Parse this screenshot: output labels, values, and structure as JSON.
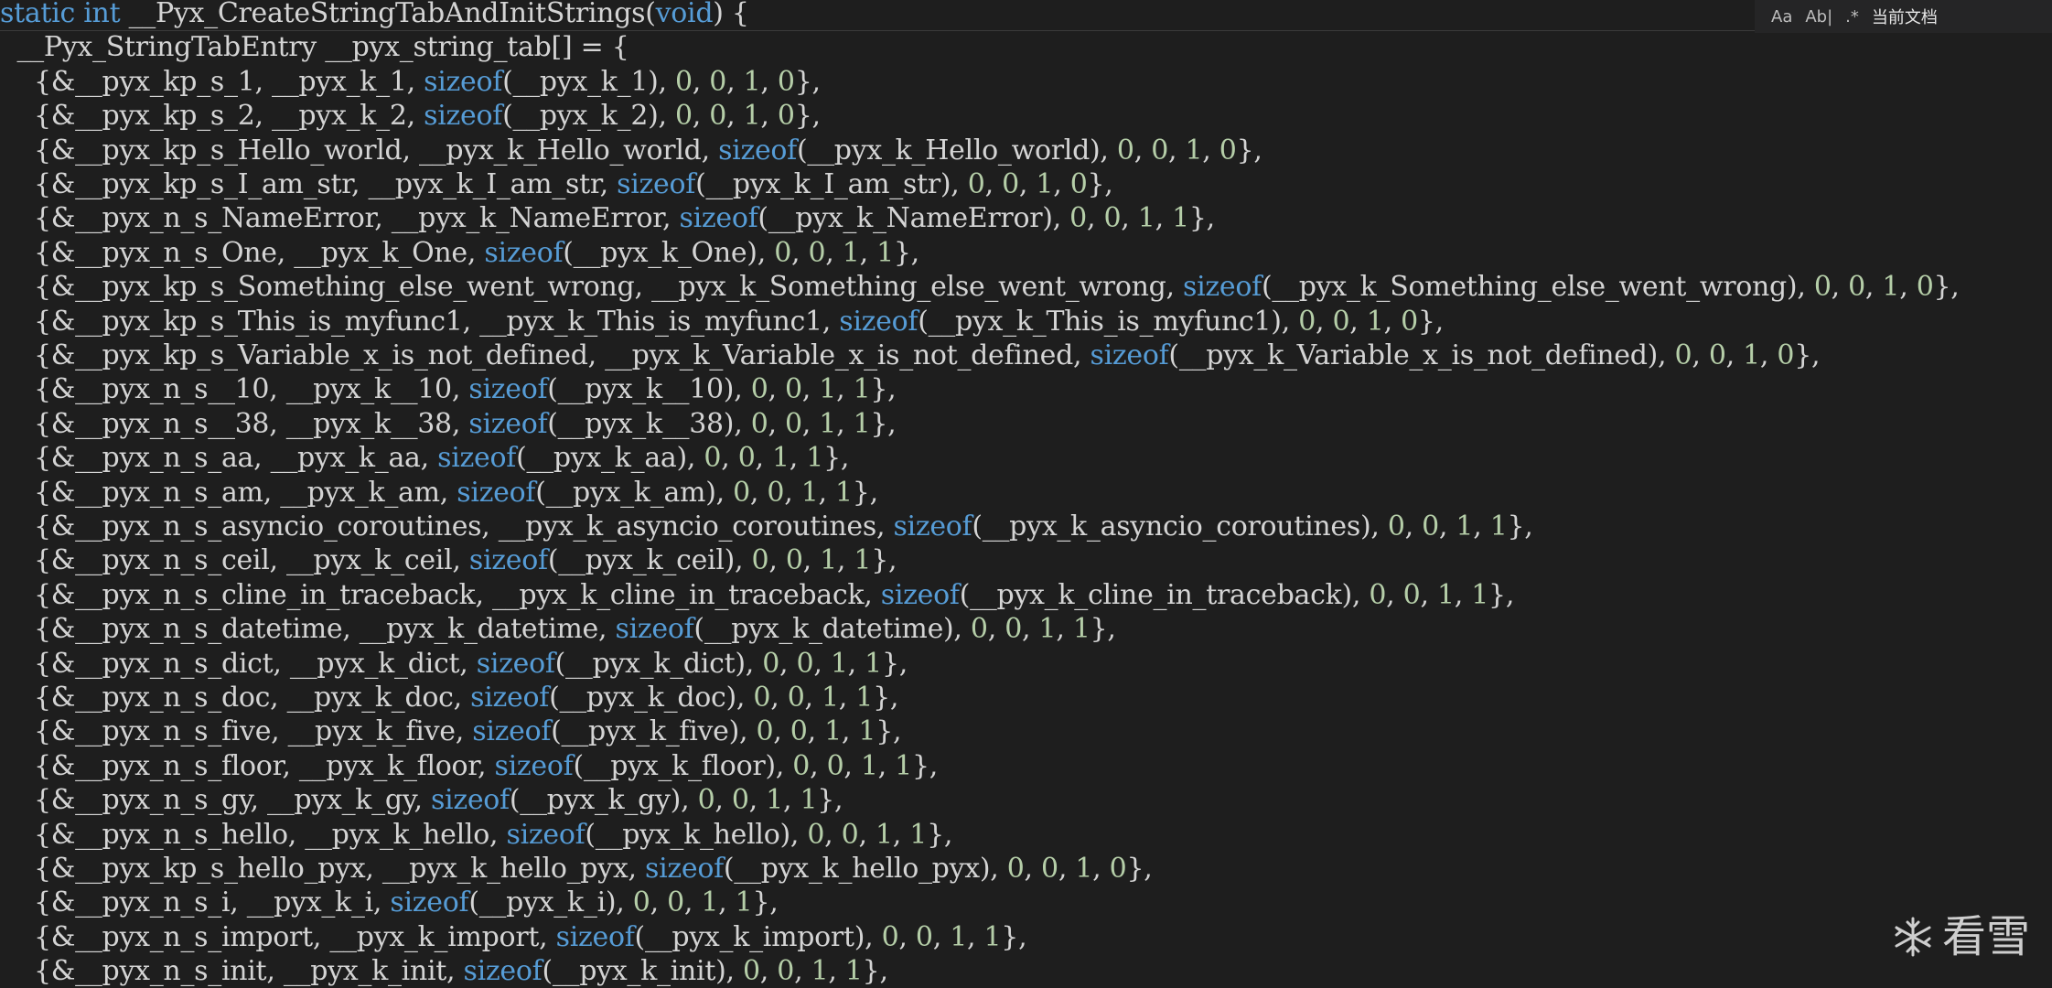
{
  "findbar": {
    "match_case_label": "Aa",
    "whole_word_label": "Ab|",
    "regex_label": ".*",
    "scope_label": "当前文档"
  },
  "editor": {
    "lines": [
      "static int __Pyx_CreateStringTabAndInitStrings(void) {",
      "  __Pyx_StringTabEntry __pyx_string_tab[] = {",
      "    {&__pyx_kp_s_1, __pyx_k_1, sizeof(__pyx_k_1), 0, 0, 1, 0},",
      "    {&__pyx_kp_s_2, __pyx_k_2, sizeof(__pyx_k_2), 0, 0, 1, 0},",
      "    {&__pyx_kp_s_Hello_world, __pyx_k_Hello_world, sizeof(__pyx_k_Hello_world), 0, 0, 1, 0},",
      "    {&__pyx_kp_s_I_am_str, __pyx_k_I_am_str, sizeof(__pyx_k_I_am_str), 0, 0, 1, 0},",
      "    {&__pyx_n_s_NameError, __pyx_k_NameError, sizeof(__pyx_k_NameError), 0, 0, 1, 1},",
      "    {&__pyx_n_s_One, __pyx_k_One, sizeof(__pyx_k_One), 0, 0, 1, 1},",
      "    {&__pyx_kp_s_Something_else_went_wrong, __pyx_k_Something_else_went_wrong, sizeof(__pyx_k_Something_else_went_wrong), 0, 0, 1, 0},",
      "    {&__pyx_kp_s_This_is_myfunc1, __pyx_k_This_is_myfunc1, sizeof(__pyx_k_This_is_myfunc1), 0, 0, 1, 0},",
      "    {&__pyx_kp_s_Variable_x_is_not_defined, __pyx_k_Variable_x_is_not_defined, sizeof(__pyx_k_Variable_x_is_not_defined), 0, 0, 1, 0},",
      "    {&__pyx_n_s__10, __pyx_k__10, sizeof(__pyx_k__10), 0, 0, 1, 1},",
      "    {&__pyx_n_s__38, __pyx_k__38, sizeof(__pyx_k__38), 0, 0, 1, 1},",
      "    {&__pyx_n_s_aa, __pyx_k_aa, sizeof(__pyx_k_aa), 0, 0, 1, 1},",
      "    {&__pyx_n_s_am, __pyx_k_am, sizeof(__pyx_k_am), 0, 0, 1, 1},",
      "    {&__pyx_n_s_asyncio_coroutines, __pyx_k_asyncio_coroutines, sizeof(__pyx_k_asyncio_coroutines), 0, 0, 1, 1},",
      "    {&__pyx_n_s_ceil, __pyx_k_ceil, sizeof(__pyx_k_ceil), 0, 0, 1, 1},",
      "    {&__pyx_n_s_cline_in_traceback, __pyx_k_cline_in_traceback, sizeof(__pyx_k_cline_in_traceback), 0, 0, 1, 1},",
      "    {&__pyx_n_s_datetime, __pyx_k_datetime, sizeof(__pyx_k_datetime), 0, 0, 1, 1},",
      "    {&__pyx_n_s_dict, __pyx_k_dict, sizeof(__pyx_k_dict), 0, 0, 1, 1},",
      "    {&__pyx_n_s_doc, __pyx_k_doc, sizeof(__pyx_k_doc), 0, 0, 1, 1},",
      "    {&__pyx_n_s_five, __pyx_k_five, sizeof(__pyx_k_five), 0, 0, 1, 1},",
      "    {&__pyx_n_s_floor, __pyx_k_floor, sizeof(__pyx_k_floor), 0, 0, 1, 1},",
      "    {&__pyx_n_s_gy, __pyx_k_gy, sizeof(__pyx_k_gy), 0, 0, 1, 1},",
      "    {&__pyx_n_s_hello, __pyx_k_hello, sizeof(__pyx_k_hello), 0, 0, 1, 1},",
      "    {&__pyx_kp_s_hello_pyx, __pyx_k_hello_pyx, sizeof(__pyx_k_hello_pyx), 0, 0, 1, 0},",
      "    {&__pyx_n_s_i, __pyx_k_i, sizeof(__pyx_k_i), 0, 0, 1, 1},",
      "    {&__pyx_n_s_import, __pyx_k_import, sizeof(__pyx_k_import), 0, 0, 1, 1},",
      "    {&__pyx_n_s_init, __pyx_k_init, sizeof(__pyx_k_init), 0, 0, 1, 1},"
    ]
  },
  "watermark": {
    "text": "看雪",
    "icon": "snowflake-icon"
  }
}
